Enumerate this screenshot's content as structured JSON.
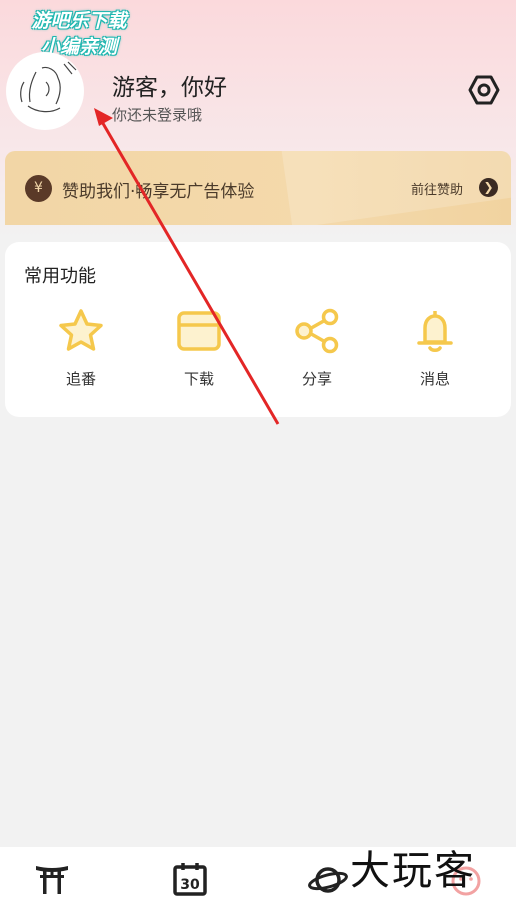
{
  "watermark": {
    "line1": "游吧乐下载",
    "line2": "小编亲测"
  },
  "profile": {
    "greeting": "游客，你好",
    "login_hint": "你还未登录哦"
  },
  "banner": {
    "icon_text": "¥",
    "text": "赞助我们·畅享无广告体验",
    "link": "前往赞助",
    "arrow": "❯"
  },
  "common": {
    "title": "常用功能",
    "items": [
      {
        "label": "追番",
        "icon": "star-icon"
      },
      {
        "label": "下载",
        "icon": "folder-icon"
      },
      {
        "label": "分享",
        "icon": "share-icon"
      },
      {
        "label": "消息",
        "icon": "bell-icon"
      }
    ]
  },
  "tabs": [
    "torii-icon",
    "calendar-icon",
    "planet-icon",
    "profile-icon"
  ],
  "calendar_day": "30",
  "brand_watermark": "大玩客",
  "colors": {
    "accent": "#f5c84c",
    "annotation": "#e32626",
    "banner": "#f2d6a6"
  }
}
